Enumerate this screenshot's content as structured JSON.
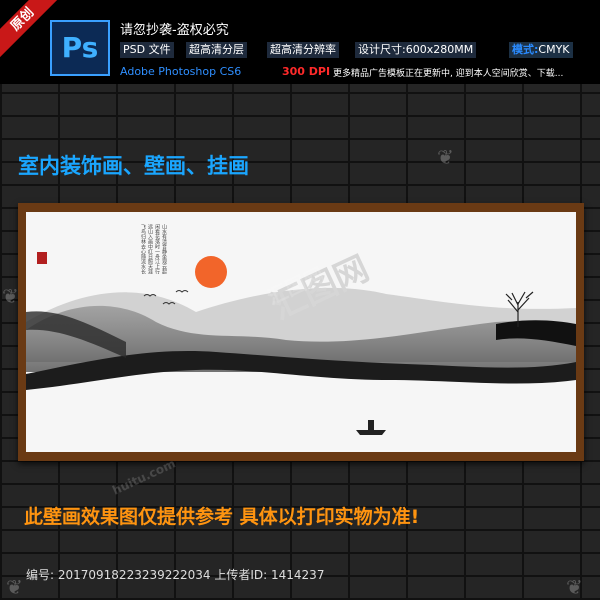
{
  "header": {
    "corner_badge": "原创",
    "logo_text": "Ps",
    "warning": "请忽抄袭-盗权必究",
    "tags": {
      "psd": "PSD 文件",
      "layers": "超高清分层",
      "resolution": "超高清分辨率",
      "size": "设计尺寸:600x280MM",
      "mode_label": "模式:",
      "mode_value": "CMYK"
    },
    "app": "Adobe Photoshop CS6",
    "dpi": "300 DPI",
    "note": "更多精品广告模板正在更新中, 迎到本人空间欣赏、下载..."
  },
  "headline": "室内装饰画、壁画、挂画",
  "painting": {
    "poem": "山水有清音静坐观云起闲看花落时一舟江上行远山入画中红日照天涯飞鸟归林去心随流水长"
  },
  "disclaimer": "此壁画效果图仅提供参考 具体以打印实物为准!",
  "footer": {
    "id_line": "编号: 20170918223239222034 上传者ID: 1414237"
  },
  "watermark": {
    "text": "汇图网",
    "url": "huitu.com"
  },
  "colors": {
    "frame": "#6a3a14",
    "headline": "#1aa6ff",
    "disclaimer": "#ff9410",
    "sun": "#f2652a",
    "dpi": "#ff2a2a"
  },
  "icons": [
    "ps-logo-icon",
    "leaf-icon",
    "sun-icon",
    "tree-icon",
    "boat-icon",
    "birds-icon",
    "seal-icon"
  ]
}
